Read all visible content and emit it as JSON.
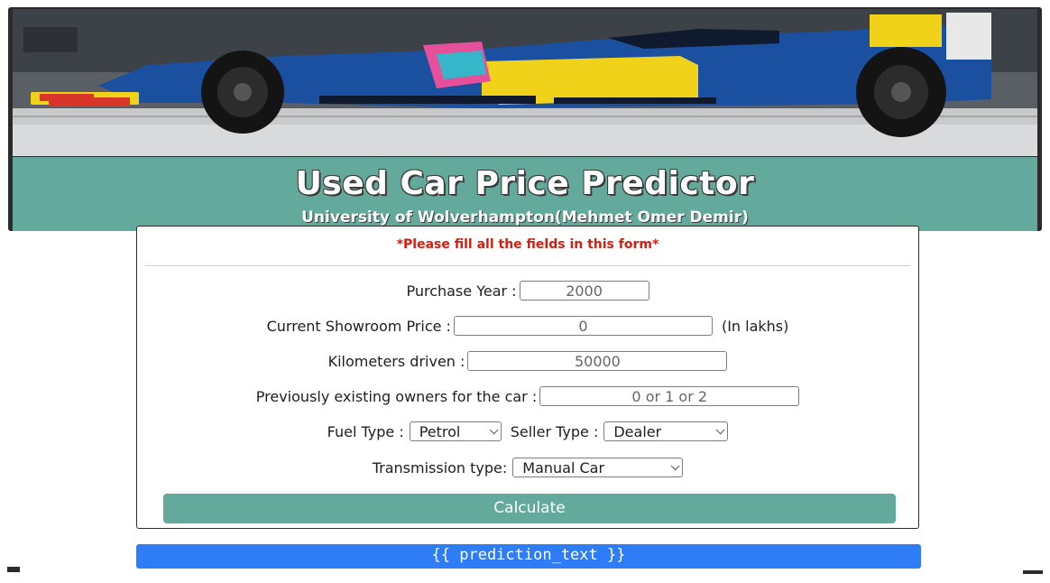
{
  "header": {
    "title": "Used Car Price Predictor",
    "subtitle": "University of Wolverhampton(Mehmet Omer Demir)",
    "hero_image": "racing-car-photo"
  },
  "form": {
    "notice": "*Please fill all the fields in this form*",
    "purchase_year": {
      "label": "Purchase Year :",
      "placeholder": "2000"
    },
    "showroom_price": {
      "label": "Current Showroom Price :",
      "placeholder": "0",
      "unit": "(In lakhs)"
    },
    "kilometers": {
      "label": "Kilometers driven :",
      "placeholder": "50000"
    },
    "owners": {
      "label": "Previously existing owners for the car :",
      "placeholder": "0 or 1 or 2"
    },
    "fuel_type": {
      "label": "Fuel Type :",
      "selected": "Petrol"
    },
    "seller_type": {
      "label": "Seller Type :",
      "selected": "Dealer"
    },
    "transmission": {
      "label": "Transmission type:",
      "selected": "Manual Car"
    },
    "submit_label": "Calculate"
  },
  "result": {
    "text": "{{ prediction_text }}"
  },
  "colors": {
    "accent": "#63a99c",
    "notice": "#d21f14",
    "result_bar": "#2e7cf6"
  }
}
